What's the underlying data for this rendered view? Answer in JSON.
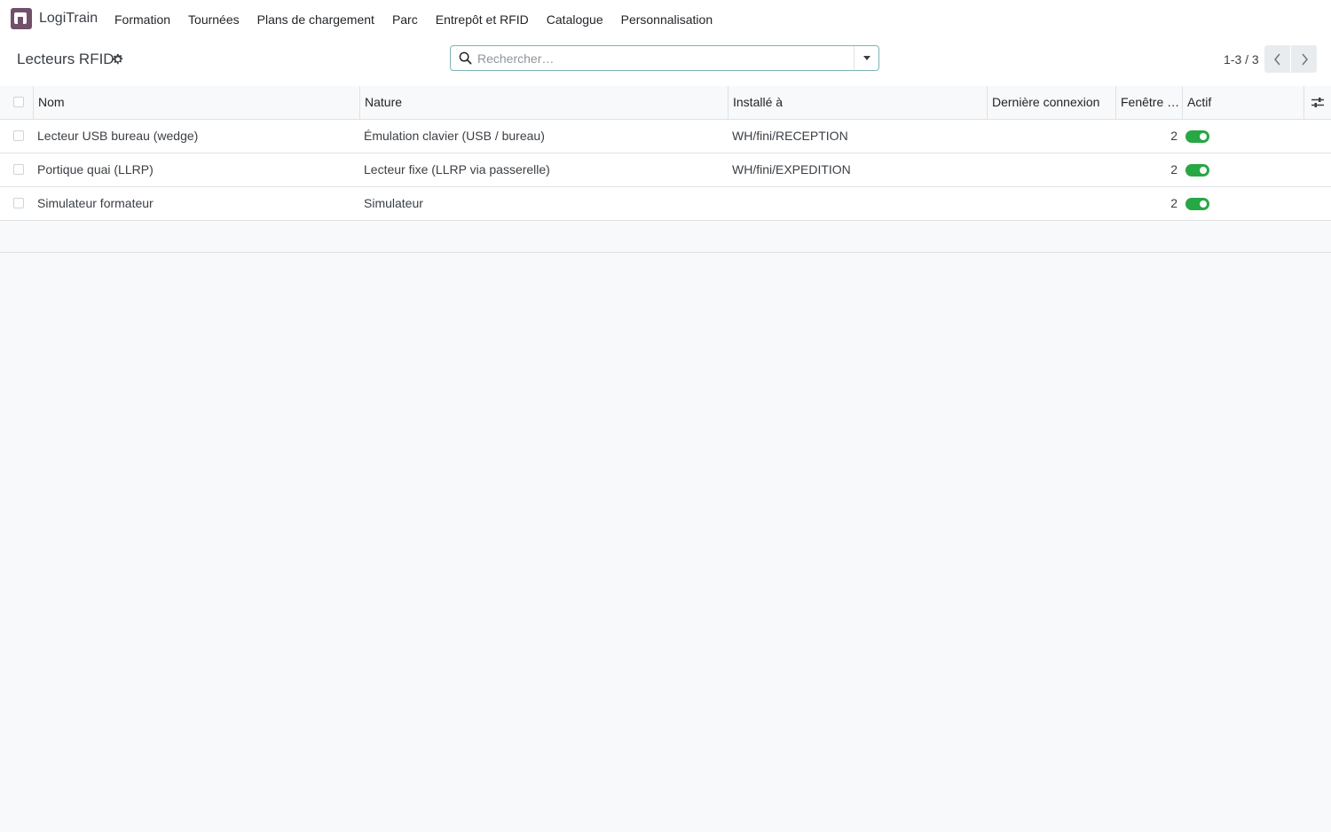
{
  "app": {
    "name": "LogiTrain"
  },
  "nav": {
    "items": [
      {
        "label": "Formation"
      },
      {
        "label": "Tournées"
      },
      {
        "label": "Plans de chargement"
      },
      {
        "label": "Parc"
      },
      {
        "label": "Entrepôt et RFID"
      },
      {
        "label": "Catalogue"
      },
      {
        "label": "Personnalisation"
      }
    ]
  },
  "control": {
    "title": "Lecteurs RFID",
    "search_placeholder": "Rechercher…",
    "search_value": "",
    "pager": "1-3 / 3"
  },
  "table": {
    "columns": [
      "Nom",
      "Nature",
      "Installé à",
      "Dernière connexion",
      "Fenêtre …",
      "Actif"
    ],
    "rows": [
      {
        "nom": "Lecteur USB bureau (wedge)",
        "nature": "Émulation clavier (USB / bureau)",
        "installe": "WH/fini/RECEPTION",
        "derniere": "",
        "fenetre": "2",
        "actif": true
      },
      {
        "nom": "Portique quai (LLRP)",
        "nature": "Lecteur fixe (LLRP via passerelle)",
        "installe": "WH/fini/EXPEDITION",
        "derniere": "",
        "fenetre": "2",
        "actif": true
      },
      {
        "nom": "Simulateur formateur",
        "nature": "Simulateur",
        "installe": "",
        "derniere": "",
        "fenetre": "2",
        "actif": true
      }
    ]
  },
  "colors": {
    "brand": "#71506a",
    "toggle_on": "#28a745",
    "search_border": "#7fb3b9"
  },
  "icons": {
    "app": "logitrain-app-icon",
    "gear": "gear-icon",
    "search": "search-icon",
    "dropdown": "caret-down-icon",
    "prev": "chevron-left-icon",
    "next": "chevron-right-icon",
    "columns": "sliders-icon"
  }
}
